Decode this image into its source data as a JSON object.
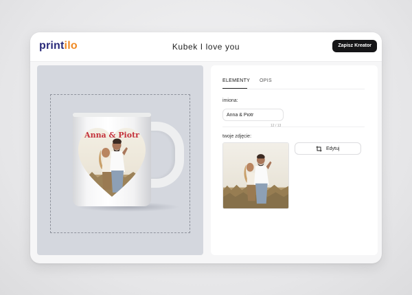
{
  "header": {
    "logo_part1": "print",
    "logo_part2": "ilo",
    "title": "Kubek I love you",
    "save_label": "Zapisz Kreator"
  },
  "preview": {
    "mug_text": "Anna & Piotr",
    "print_shape": "heart"
  },
  "panel": {
    "tabs": [
      {
        "label": "ELEMENTY",
        "active": true
      },
      {
        "label": "OPIS",
        "active": false
      }
    ],
    "names_label": "imiona:",
    "names_value": "Anna & Piotr",
    "names_counter": "12 / 13",
    "photo_label": "twoje zdjęcie:",
    "edit_label": "Edytuj",
    "edit_icon": "crop-icon"
  },
  "colors": {
    "brand_dark": "#2a2a7a",
    "brand_orange": "#f08a24",
    "mug_text": "#c3303a",
    "save_button": "#151517"
  }
}
